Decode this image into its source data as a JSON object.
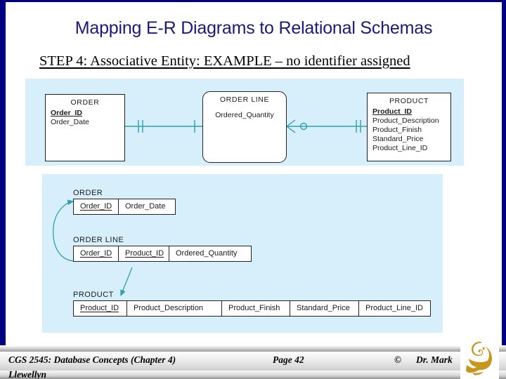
{
  "slide": {
    "title": "Mapping E-R Diagrams to Relational Schemas",
    "subtitle": "STEP 4:  Associative Entity: EXAMPLE – no identifier assigned",
    "title_color": "#1a1a7a",
    "panel_color": "#d7effb",
    "line_color": "#2f9fb0"
  },
  "er_diagram": {
    "entities": [
      {
        "name": "ORDER",
        "shape": "rectangle",
        "attributes": [
          {
            "label": "Order_ID",
            "key": true
          },
          {
            "label": "Order_Date",
            "key": false
          }
        ]
      },
      {
        "name": "ORDER LINE",
        "shape": "rounded-rectangle",
        "attributes": [
          {
            "label": "Ordered_Quantity",
            "key": false
          }
        ]
      },
      {
        "name": "PRODUCT",
        "shape": "rectangle",
        "attributes": [
          {
            "label": "Product_ID",
            "key": true
          },
          {
            "label": "Product_Description",
            "key": false
          },
          {
            "label": "Product_Finish",
            "key": false
          },
          {
            "label": "Standard_Price",
            "key": false
          },
          {
            "label": "Product_Line_ID",
            "key": false
          }
        ]
      }
    ],
    "relationships": [
      {
        "from": "ORDER",
        "to": "ORDER LINE",
        "from_cardinality": "one-mandatory",
        "to_cardinality": "many-mandatory"
      },
      {
        "from": "ORDER LINE",
        "to": "PRODUCT",
        "from_cardinality": "zero-or-many",
        "to_cardinality": "one-mandatory"
      }
    ]
  },
  "relational_schema": {
    "relations": [
      {
        "name": "ORDER",
        "columns": [
          {
            "label": "Order_ID",
            "key": true
          },
          {
            "label": "Order_Date",
            "key": false
          }
        ]
      },
      {
        "name": "ORDER LINE",
        "columns": [
          {
            "label": "Order_ID",
            "key": true
          },
          {
            "label": "Product_ID",
            "key": true
          },
          {
            "label": "Ordered_Quantity",
            "key": false
          }
        ]
      },
      {
        "name": "PRODUCT",
        "columns": [
          {
            "label": "Product_ID",
            "key": true
          },
          {
            "label": "Product_Description",
            "key": false
          },
          {
            "label": "Product_Finish",
            "key": false
          },
          {
            "label": "Standard_Price",
            "key": false
          },
          {
            "label": "Product_Line_ID",
            "key": false
          }
        ]
      }
    ],
    "foreign_key_arrows": [
      {
        "from": "ORDER LINE.Order_ID",
        "to": "ORDER.Order_ID"
      },
      {
        "from": "ORDER LINE.Product_ID",
        "to": "PRODUCT.Product_ID"
      }
    ]
  },
  "footer": {
    "course": "CGS 2545: Database Concepts  (Chapter 4)",
    "page": "Page 42",
    "copyright": "©",
    "author": "Dr. Mark",
    "author_line2": "Llewellyn",
    "logo": "pegasus-logo",
    "logo_color": "#c9961d"
  }
}
